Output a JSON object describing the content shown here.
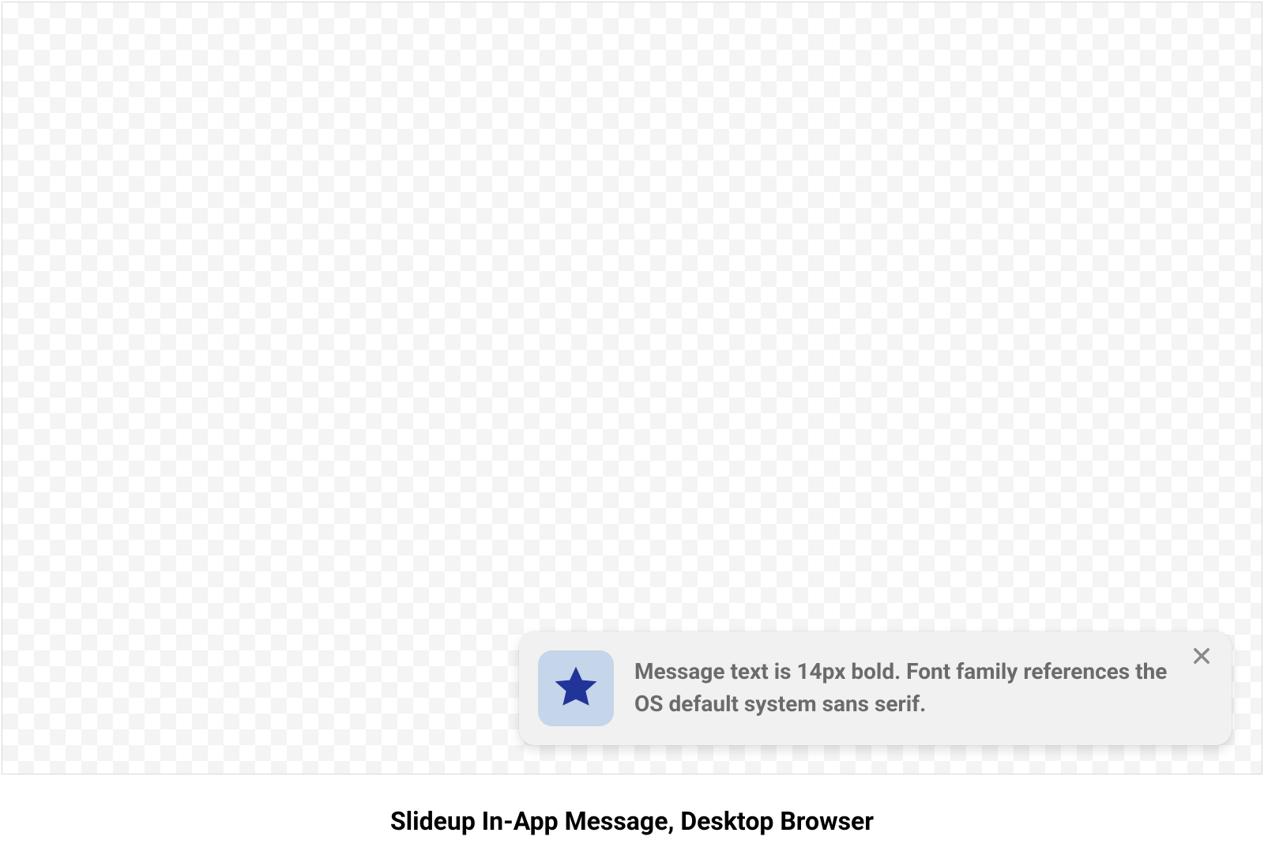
{
  "slideup": {
    "message": "Message text is 14px bold. Font family references the OS default system sans serif.",
    "icon": "star-icon",
    "icon_bg": "#C5D5EA",
    "icon_fill": "#22339A",
    "background": "#F1F1F1",
    "text_color": "#6B6B6B"
  },
  "caption": "Slideup In-App Message, Desktop Browser"
}
